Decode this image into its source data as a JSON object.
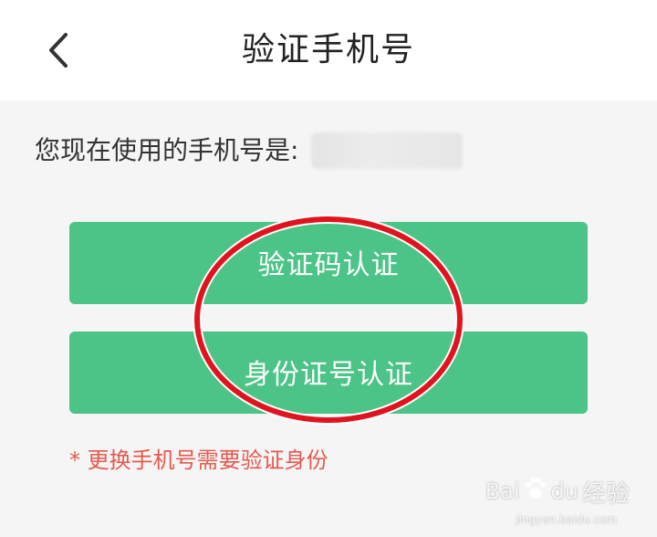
{
  "header": {
    "title": "验证手机号",
    "back_icon": "chevron-left-icon"
  },
  "phone": {
    "label": "您现在使用的手机号是:",
    "value": "***********"
  },
  "buttons": {
    "code_verify": "验证码认证",
    "id_verify": "身份证号认证"
  },
  "note": "* 更换手机号需要验证身份",
  "colors": {
    "primary_green": "#4cc487",
    "note_red": "#e55a4e",
    "annotation_red": "#e0141e"
  },
  "watermark": {
    "brand_left": "Bai",
    "brand_right": "du",
    "product": "经验",
    "url": "jingyan.baidu.com"
  }
}
